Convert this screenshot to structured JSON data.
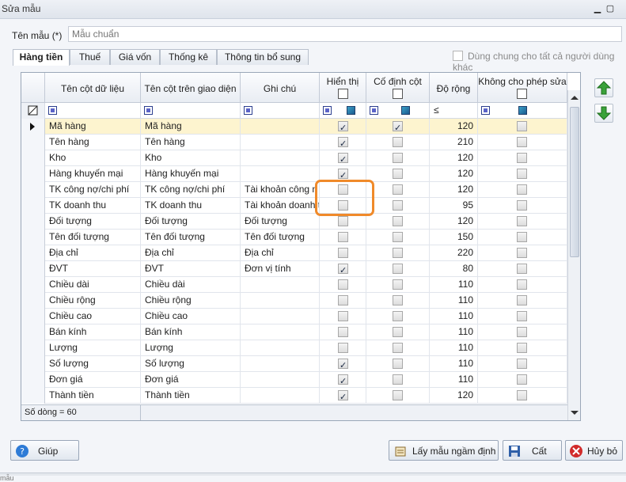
{
  "window": {
    "title": "Sửa mẫu",
    "minimize_glyph": "▁",
    "maximize_glyph": "▢"
  },
  "form": {
    "name_label": "Tên mẫu (*)",
    "name_placeholder": "Mẫu chuẩn",
    "tabs": [
      {
        "label": "Hàng tiền",
        "active": true
      },
      {
        "label": "Thuế",
        "active": false
      },
      {
        "label": "Giá vốn",
        "active": false
      },
      {
        "label": "Thống kê",
        "active": false
      },
      {
        "label": "Thông tin bổ sung",
        "active": false
      }
    ],
    "share_label": "Dùng chung cho tất cả người dùng khác",
    "share_checked": false
  },
  "grid": {
    "columns": {
      "field": "Tên cột dữ liệu",
      "display": "Tên cột trên giao diện",
      "note": "Ghi chú",
      "visible": "Hiển thị",
      "fixed": "Cố định cột",
      "width": "Độ rộng",
      "noedit": "Không cho phép sửa"
    },
    "filter_operator": "≤",
    "rows": [
      {
        "field": "Mã hàng",
        "display": "Mã hàng",
        "note": "",
        "visible": true,
        "fixed": true,
        "width": "120",
        "noedit": false,
        "selected": true
      },
      {
        "field": "Tên hàng",
        "display": "Tên hàng",
        "note": "",
        "visible": true,
        "fixed": false,
        "width": "210",
        "noedit": false
      },
      {
        "field": "Kho",
        "display": "Kho",
        "note": "",
        "visible": true,
        "fixed": false,
        "width": "120",
        "noedit": false
      },
      {
        "field": "Hàng khuyến mại",
        "display": "Hàng khuyến mại",
        "note": "",
        "visible": true,
        "fixed": false,
        "width": "120",
        "noedit": false
      },
      {
        "field": "TK công nợ/chi phí",
        "display": "TK công nợ/chi phí",
        "note": "Tài khoản công n",
        "visible": false,
        "fixed": false,
        "width": "120",
        "noedit": false
      },
      {
        "field": "TK doanh thu",
        "display": "TK doanh thu",
        "note": "Tài khoản doanh t",
        "visible": false,
        "fixed": false,
        "width": "95",
        "noedit": false
      },
      {
        "field": "Đối tượng",
        "display": "Đối tượng",
        "note": "Đối tượng",
        "visible": false,
        "fixed": false,
        "width": "120",
        "noedit": false
      },
      {
        "field": "Tên đối tượng",
        "display": "Tên đối tượng",
        "note": "Tên đối tượng",
        "visible": false,
        "fixed": false,
        "width": "150",
        "noedit": false
      },
      {
        "field": "Địa chỉ",
        "display": "Địa chỉ",
        "note": "Địa chỉ",
        "visible": false,
        "fixed": false,
        "width": "220",
        "noedit": false
      },
      {
        "field": "ĐVT",
        "display": "ĐVT",
        "note": "Đơn vị tính",
        "visible": true,
        "fixed": false,
        "width": "80",
        "noedit": false
      },
      {
        "field": "Chiều dài",
        "display": "Chiều dài",
        "note": "",
        "visible": false,
        "fixed": false,
        "width": "110",
        "noedit": false
      },
      {
        "field": "Chiều rộng",
        "display": "Chiều rộng",
        "note": "",
        "visible": false,
        "fixed": false,
        "width": "110",
        "noedit": false
      },
      {
        "field": "Chiều cao",
        "display": "Chiều cao",
        "note": "",
        "visible": false,
        "fixed": false,
        "width": "110",
        "noedit": false
      },
      {
        "field": "Bán kính",
        "display": "Bán kính",
        "note": "",
        "visible": false,
        "fixed": false,
        "width": "110",
        "noedit": false
      },
      {
        "field": "Lượng",
        "display": "Lượng",
        "note": "",
        "visible": false,
        "fixed": false,
        "width": "110",
        "noedit": false
      },
      {
        "field": "Số lượng",
        "display": "Số lượng",
        "note": "",
        "visible": true,
        "fixed": false,
        "width": "110",
        "noedit": false
      },
      {
        "field": "Đơn giá",
        "display": "Đơn giá",
        "note": "",
        "visible": true,
        "fixed": false,
        "width": "110",
        "noedit": false
      },
      {
        "field": "Thành tiền",
        "display": "Thành tiền",
        "note": "",
        "visible": true,
        "fixed": false,
        "width": "120",
        "noedit": false
      }
    ],
    "footer": "Số dòng = 60"
  },
  "buttons": {
    "help": "Giúp",
    "default_template": "Lấy mẫu ngầm định",
    "save": "Cất",
    "cancel": "Hủy bỏ"
  },
  "colors": {
    "accent_orange": "#f08a2a",
    "selected_row": "#fdf4cf",
    "arrow_green": "#3aa23a"
  },
  "icons": [
    "help-icon",
    "template-icon",
    "save-icon",
    "cancel-icon",
    "arrow-up-icon",
    "arrow-down-icon",
    "row-pointer-icon"
  ],
  "background_text": "mẫu"
}
